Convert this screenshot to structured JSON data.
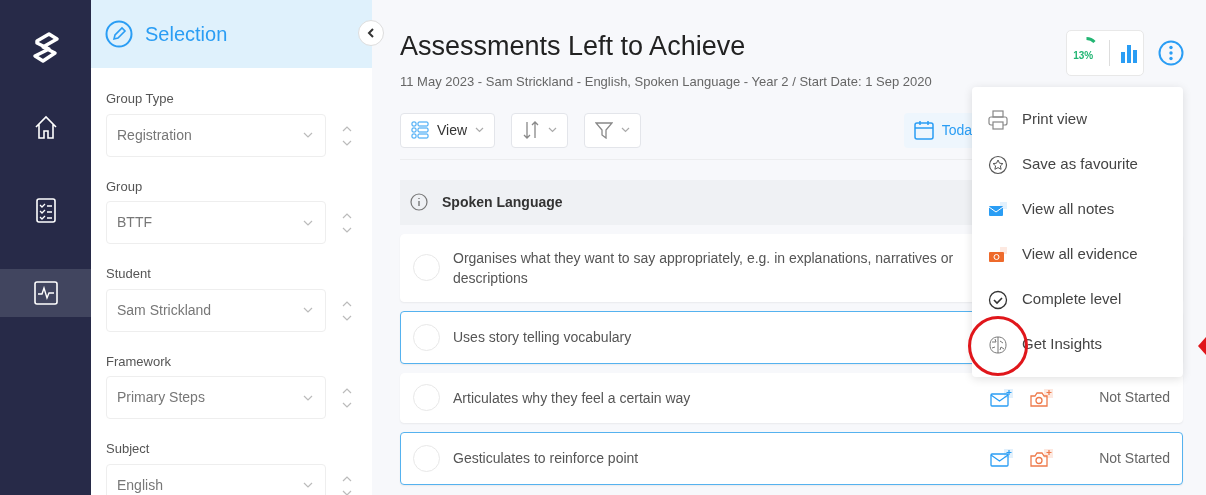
{
  "nav": [
    {
      "kind": "home",
      "selected": false
    },
    {
      "kind": "checklist",
      "selected": false
    },
    {
      "kind": "activity",
      "selected": true
    }
  ],
  "sidebar": {
    "title": "Selection",
    "fields": [
      {
        "label": "Group Type",
        "value": "Registration"
      },
      {
        "label": "Group",
        "value": "BTTF"
      },
      {
        "label": "Student",
        "value": "Sam Strickland"
      },
      {
        "label": "Framework",
        "value": "Primary Steps"
      },
      {
        "label": "Subject",
        "value": "English"
      }
    ]
  },
  "header": {
    "title": "Assessments Left to Achieve",
    "subtitle": "11 May 2023 - Sam Strickland - English, Spoken Language - Year 2 / Start Date: 1 Sep 2020",
    "progress": {
      "label": "13%"
    }
  },
  "toolbar": [
    {
      "kind": "view",
      "label": "View"
    },
    {
      "kind": "sort"
    },
    {
      "kind": "filter"
    },
    {
      "kind": "date",
      "label": "Toda"
    }
  ],
  "section": {
    "title": "Spoken Language"
  },
  "rows": [
    {
      "text": "Organises what they want to say appropriately, e.g. in explanations, narratives or descriptions",
      "selected": false
    },
    {
      "text": "Uses story telling vocabulary",
      "selected": true
    },
    {
      "text": "Articulates why they feel a certain way",
      "selected": false,
      "status": "Not Started"
    },
    {
      "text": "Gesticulates to reinforce point",
      "selected": true,
      "status": "Not Started"
    }
  ],
  "menu": [
    {
      "kind": "print",
      "label": "Print view"
    },
    {
      "kind": "star",
      "label": "Save as favourite"
    },
    {
      "kind": "notes",
      "label": "View all notes"
    },
    {
      "kind": "evidence",
      "label": "View all evidence"
    },
    {
      "kind": "check",
      "label": "Complete level"
    },
    {
      "kind": "brain",
      "label": "Get Insights"
    }
  ]
}
